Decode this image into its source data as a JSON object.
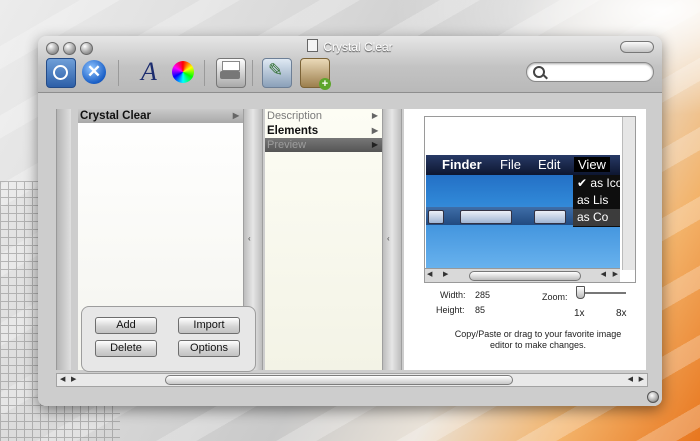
{
  "window": {
    "title": "Crystal Clear",
    "search": {
      "value": "",
      "placeholder": ""
    }
  },
  "toolbar": {
    "icons": [
      "preview-icon",
      "close-icon",
      "font-icon",
      "colors-icon",
      "print-icon",
      "edit-icon",
      "photo-add-icon"
    ],
    "font_glyph": "A"
  },
  "columns": {
    "first": {
      "items": [
        {
          "label": "Crystal Clear",
          "selected": true
        }
      ]
    },
    "second": {
      "items": [
        {
          "label": "Description",
          "style": "grey"
        },
        {
          "label": "Elements",
          "style": "bold"
        },
        {
          "label": "Preview",
          "style": "selected-dark"
        }
      ]
    }
  },
  "buttons": {
    "add": "Add",
    "import": "Import",
    "delete": "Delete",
    "options": "Options"
  },
  "preview": {
    "menu": {
      "app": "Finder",
      "file": "File",
      "edit": "Edit",
      "view": "View"
    },
    "dropdown": {
      "item1": "✔ as Ico",
      "item2": "as Lis",
      "item3": "as Co"
    },
    "width_label": "Width:",
    "width_value": "285",
    "height_label": "Height:",
    "height_value": "85",
    "zoom_label": "Zoom:",
    "zoom_min": "1x",
    "zoom_max": "8x",
    "zoom_level": 1,
    "hint": "Copy/Paste or drag to your favorite image editor to make changes."
  },
  "colors": {
    "accent": "#2d5fa8",
    "selection": "#a9a9a9"
  }
}
